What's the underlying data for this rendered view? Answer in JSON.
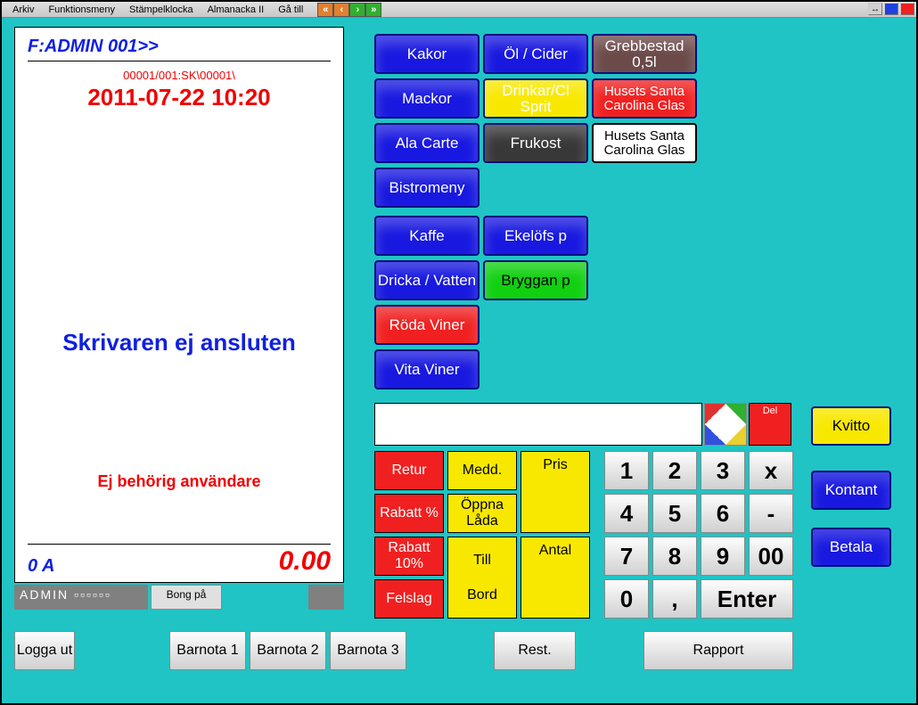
{
  "menubar": {
    "items": [
      "Arkiv",
      "Funktionsmeny",
      "Stämpelklocka",
      "Almanacka II",
      "Gå till"
    ]
  },
  "receipt": {
    "header": "F:ADMIN  001>>",
    "code": "00001/001:SK\\00001\\",
    "datetime": "2011-07-22 10:20",
    "msg_blue": "Skrivaren ej ansluten",
    "msg_red": "Ej behörig användare",
    "account": "0 A",
    "total": "0.00"
  },
  "status": {
    "left": "ADMIN ▫▫▫▫▫▫",
    "mid": "Bong på"
  },
  "tiles": {
    "c1r1": "Kakor",
    "c2r1": "Öl / Cider",
    "c3r1": "Grebbestad 0,5l",
    "c1r2": "Mackor",
    "c2r2": "Drinkar/Cl Sprit",
    "c3r2": "Husets Santa Carolina Glas",
    "c1r3": "Ala Carte",
    "c2r3": "Frukost",
    "c3r3": "Husets Santa Carolina Glas",
    "c1r4": "Bistromeny",
    "c1r5": "Kaffe",
    "c2r5": "Ekelöfs p",
    "c1r6": "Dricka / Vatten",
    "c2r6": "Bryggan p",
    "c1r7": "Röda Viner",
    "c1r8": "Vita Viner"
  },
  "fn": {
    "retur": "Retur",
    "medd": "Medd.",
    "pris": "Pris",
    "rabattpct": "Rabatt %",
    "oppna": "Öppna Låda",
    "rabatt10": "Rabatt 10%",
    "till": "Till",
    "antal": "Antal",
    "felslag": "Felslag",
    "bord": "Bord"
  },
  "keys": {
    "k1": "1",
    "k2": "2",
    "k3": "3",
    "kx": "x",
    "k4": "4",
    "k5": "5",
    "k6": "6",
    "kminus": "-",
    "k7": "7",
    "k8": "8",
    "k9": "9",
    "k00": "00",
    "k0": "0",
    "kcomma": ",",
    "kenter": "Enter"
  },
  "del": "Del",
  "pay": {
    "kvitto": "Kvitto",
    "kontant": "Kontant",
    "betala": "Betala"
  },
  "bottom": {
    "loggaut": "Logga ut",
    "barnota1": "Barnota 1",
    "barnota2": "Barnota 2",
    "barnota3": "Barnota 3",
    "rest": "Rest.",
    "rapport": "Rapport"
  }
}
